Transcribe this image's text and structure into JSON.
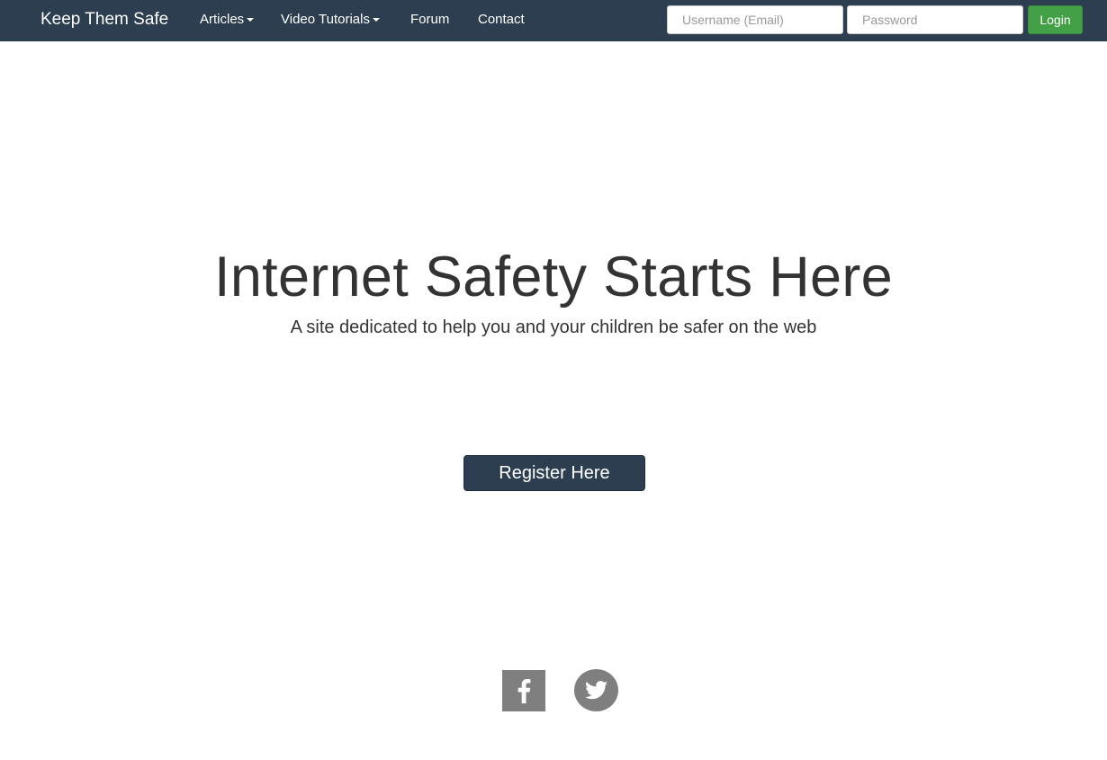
{
  "navbar": {
    "brand": "Keep Them Safe",
    "links": [
      {
        "label": "Articles",
        "dropdown": true
      },
      {
        "label": "Video Tutorials",
        "dropdown": true
      },
      {
        "label": "Forum",
        "dropdown": false
      },
      {
        "label": "Contact",
        "dropdown": false
      }
    ],
    "username_placeholder": "Username (Email)",
    "password_placeholder": "Password",
    "login_label": "Login"
  },
  "hero": {
    "title": "Internet Safety Starts Here",
    "subtitle": "A site dedicated to help you and your children be safer on the web",
    "register_label": "Register Here"
  },
  "social": [
    {
      "icon": "facebook-icon"
    },
    {
      "icon": "twitter-icon"
    }
  ],
  "colors": {
    "navbar_bg": "#2c3e50",
    "login_green": "#43a047",
    "register_bg": "#2c3e50",
    "social_gray": "#7f7f7f"
  }
}
